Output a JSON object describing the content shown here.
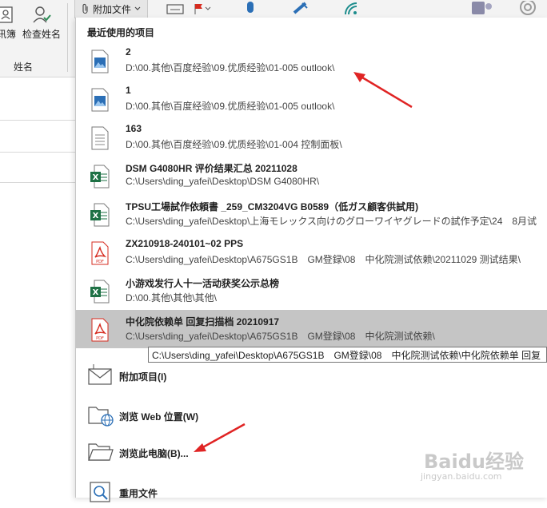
{
  "ribbon": {
    "address_book_label": "讯簿",
    "check_names_label": "检查姓名",
    "group_label": "姓名",
    "attach_file_label": "附加文件"
  },
  "dropdown": {
    "section_title": "最近使用的项目",
    "items": [
      {
        "name": "2",
        "path": "D:\\00.其他\\百度经验\\09.优质经验\\01-005 outlook\\",
        "icon": "image-file-icon"
      },
      {
        "name": "1",
        "path": "D:\\00.其他\\百度经验\\09.优质经验\\01-005 outlook\\",
        "icon": "image-file-icon"
      },
      {
        "name": "163",
        "path": "D:\\00.其他\\百度经验\\09.优质经验\\01-004 控制面板\\",
        "icon": "text-file-icon"
      },
      {
        "name": "DSM G4080HR 评价结果汇总 20211028",
        "path": "C:\\Users\\ding_yafei\\Desktop\\DSM G4080HR\\",
        "icon": "excel-file-icon"
      },
      {
        "name": "TPSU工場試作依頼書 _259_CM3204VG B0589（低ガス顧客供試用)",
        "path": "C:\\Users\\ding_yafei\\Desktop\\上海モレックス向けのグローワイヤグレードの試作予定\\24　8月试",
        "icon": "excel-file-icon"
      },
      {
        "name": "ZX210918-240101~02 PPS",
        "path": "C:\\Users\\ding_yafei\\Desktop\\A675GS1B　GM登録\\08　中化院测试依赖\\20211029 测试结果\\",
        "icon": "pdf-file-icon"
      },
      {
        "name": "小游戏发行人十一活动获奖公示总榜",
        "path": "D:\\00.其他\\其他\\其他\\",
        "icon": "excel-file-icon"
      },
      {
        "name": "中化院依赖单 回复扫描档 20210917",
        "path": "C:\\Users\\ding_yafei\\Desktop\\A675GS1B　GM登録\\08　中化院测试依赖\\",
        "icon": "pdf-file-icon"
      }
    ],
    "tooltip": "C:\\Users\\ding_yafei\\Desktop\\A675GS1B　GM登録\\08　中化院测试依赖\\中化院依赖单 回复",
    "actions": [
      {
        "label": "附加项目(I)",
        "icon": "envelope-attach-icon"
      },
      {
        "label": "浏览 Web 位置(W)",
        "icon": "folder-globe-icon"
      },
      {
        "label": "浏览此电脑(B)...",
        "icon": "folder-icon"
      },
      {
        "label": "重用文件",
        "icon": "search-file-icon"
      }
    ]
  },
  "watermark": {
    "brand": "Baidu经验",
    "url": "jingyan.baidu.com"
  },
  "colors": {
    "selected_row": "#c5c5c5",
    "excel_green": "#1e7145",
    "pdf_red": "#d62b1f",
    "image_blue": "#2b6fb6",
    "arrow_red": "#e02424"
  }
}
